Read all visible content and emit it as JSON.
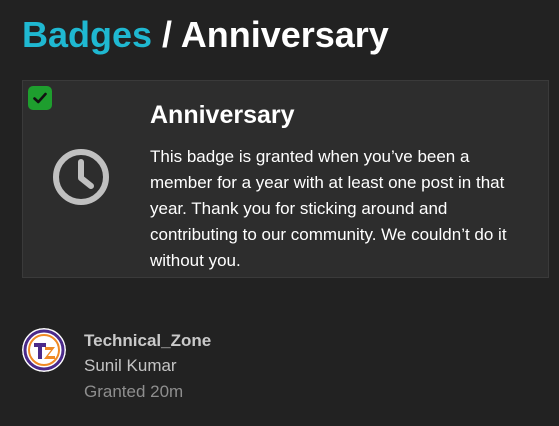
{
  "breadcrumb": {
    "parent_label": "Badges",
    "separator": " / ",
    "current_label": "Anniversary"
  },
  "badge": {
    "name": "Anniversary",
    "description": "This badge is granted when you’ve been a member for a year with at least one post in that year. Thank you for sticking around and contributing to our community. We couldn’t do it without you.",
    "icon": "clock-icon",
    "status_icon": "checkmark-icon",
    "granted": true
  },
  "grant": {
    "avatar_icon": "tz-avatar",
    "avatar_text": "TZ",
    "username": "Technical_Zone",
    "full_name": "Sunil Kumar",
    "granted_text": "Granted 20m"
  },
  "colors": {
    "background": "#222222",
    "card": "#2d2d2d",
    "accent": "#1fb8d1",
    "check": "#1e9e2e",
    "icon_gray": "#c0c0c0",
    "muted_text": "#8e8e8e"
  }
}
